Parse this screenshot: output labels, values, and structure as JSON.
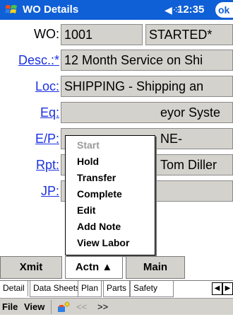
{
  "titlebar": {
    "title": "WO Details",
    "time": "12:35",
    "speaker_icon": "speaker-icon",
    "ok_label": "ok"
  },
  "form": {
    "wo_label": "WO:",
    "wo_value": "1001",
    "status_value": "STARTED*",
    "desc_label": "Desc.:*",
    "desc_value": "12 Month Service on Shi",
    "loc_label": "Loc:",
    "loc_value": "SHIPPING - Shipping an",
    "eq_label": "Eq:",
    "eq_value": "eyor Syste",
    "ep_label": "E/P:",
    "ep_value": "NE-",
    "rpt_label": "Rpt:",
    "rpt_value": "Tom Diller",
    "jp_label": "JP:"
  },
  "menu": {
    "items": [
      "Start",
      "Hold",
      "Transfer",
      "Complete",
      "Edit",
      "Add Note",
      "View Labor"
    ]
  },
  "buttons": {
    "xmit": "Xmit",
    "actn": "Actn ▲",
    "main": "Main"
  },
  "tabs": [
    "Detail",
    "Data Sheets",
    "Plan",
    "Parts",
    "Safety"
  ],
  "menubar": {
    "file": "File",
    "view": "View",
    "back": "<<",
    "forward": ">>"
  },
  "colors": {
    "titlebar": "#0f5fd6",
    "field_bg": "#d4d2cc",
    "link": "#1b30e0"
  }
}
